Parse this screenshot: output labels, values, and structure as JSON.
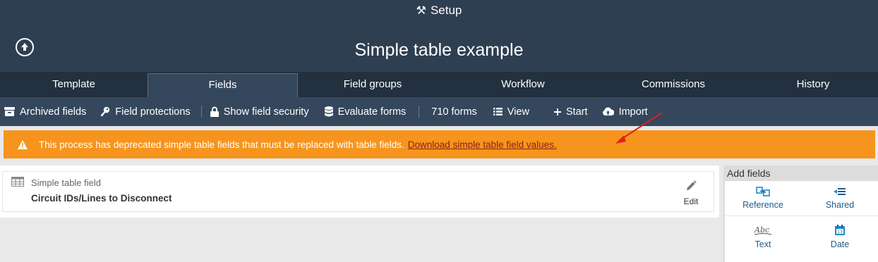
{
  "header": {
    "setup_label": "Setup",
    "title": "Simple table example",
    "back_icon": "arrow-up-circle-icon"
  },
  "tabs": [
    {
      "label": "Template",
      "active": false
    },
    {
      "label": "Fields",
      "active": true
    },
    {
      "label": "Field groups",
      "active": false
    },
    {
      "label": "Workflow",
      "active": false
    },
    {
      "label": "Commissions",
      "active": false
    },
    {
      "label": "History",
      "active": false
    }
  ],
  "toolbar": {
    "archived": "Archived fields",
    "protections": "Field protections",
    "security": "Show field security",
    "evaluate": "Evaluate forms",
    "forms_count": "710 forms",
    "view": "View",
    "start": "Start",
    "import": "Import"
  },
  "alert": {
    "message": "This process has deprecated simple table fields that must be replaced with table fields.",
    "link": "Download simple table field values."
  },
  "field": {
    "type": "Simple table field",
    "name": "Circuit IDs/Lines to Disconnect",
    "edit_label": "Edit"
  },
  "add_fields": {
    "title": "Add fields",
    "items": [
      {
        "label": "Reference",
        "icon": "reference-icon"
      },
      {
        "label": "Shared",
        "icon": "shared-icon"
      },
      {
        "label": "Text",
        "icon": "text-icon"
      },
      {
        "label": "Date",
        "icon": "calendar-icon"
      }
    ]
  },
  "colors": {
    "header_bg": "#2f3f52",
    "tabs_bg": "#22303f",
    "toolbar_bg": "#34475c",
    "alert_bg": "#f7941d",
    "link": "#8b1e1e",
    "accent_blue": "#1e5b8e"
  }
}
